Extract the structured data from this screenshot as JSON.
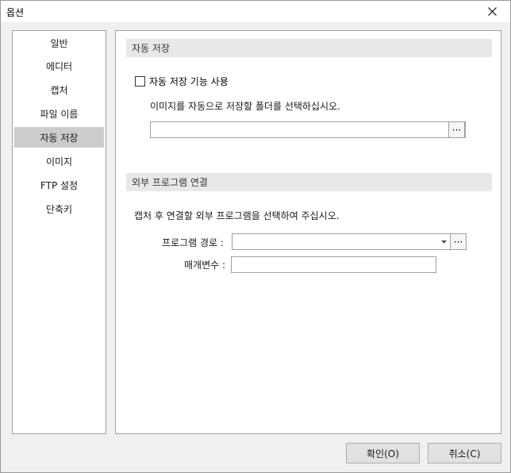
{
  "window": {
    "title": "옵션"
  },
  "sidebar": {
    "items": [
      {
        "label": "일반"
      },
      {
        "label": "에디터"
      },
      {
        "label": "캡처"
      },
      {
        "label": "파일 이름"
      },
      {
        "label": "자동 저장",
        "selected": true
      },
      {
        "label": "이미지"
      },
      {
        "label": "FTP 설정"
      },
      {
        "label": "단축키"
      }
    ]
  },
  "autosave": {
    "header": "자동 저장",
    "checkbox_label": "자동 저장 기능 사용",
    "checked": false,
    "folder_instruction": "이미지를 자동으로 저장할 폴더를 선택하십시오.",
    "folder_value": "",
    "browse_label": "···"
  },
  "external": {
    "header": "외부 프로그램 연결",
    "instruction": "캡처 후 연결할 외부 프로그램을 선택하여 주십시오.",
    "program_path_label": "프로그램 경로 :",
    "program_path_value": "",
    "params_label": "매개변수 :",
    "params_value": "",
    "browse_label": "···"
  },
  "buttons": {
    "ok_label": "확인(O)",
    "cancel_label": "취소(C)"
  }
}
